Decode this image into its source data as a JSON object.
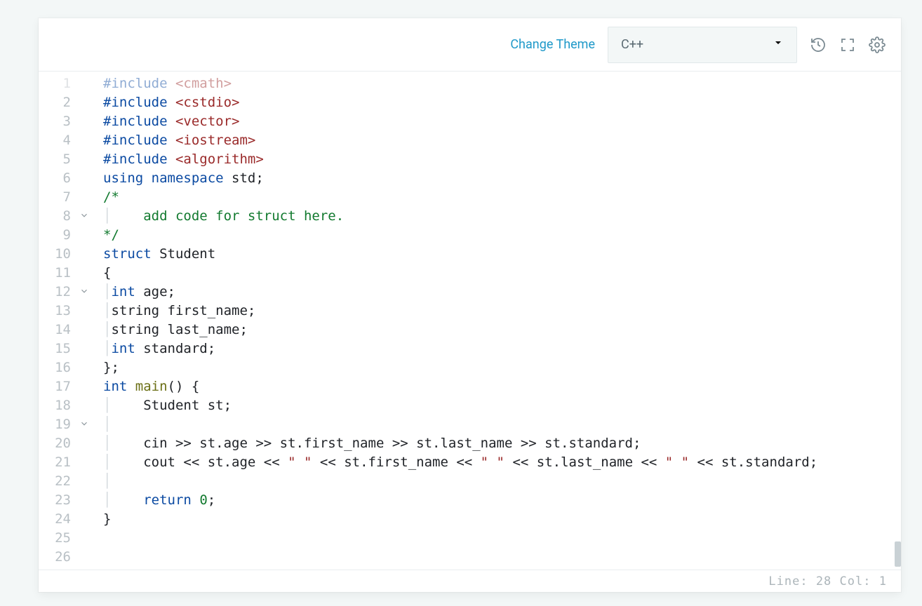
{
  "toolbar": {
    "change_theme": "Change Theme",
    "language": "C++",
    "icons": {
      "history": "history-icon",
      "fullscreen": "fullscreen-icon",
      "settings": "settings-icon"
    }
  },
  "status": {
    "line_label": "Line:",
    "line": "28",
    "col_label": "Col:",
    "col": "1"
  },
  "gutter": [
    {
      "n": "1",
      "fold": false,
      "faded": true
    },
    {
      "n": "2",
      "fold": false
    },
    {
      "n": "3",
      "fold": false
    },
    {
      "n": "4",
      "fold": false
    },
    {
      "n": "5",
      "fold": false
    },
    {
      "n": "6",
      "fold": false
    },
    {
      "n": "7",
      "fold": false
    },
    {
      "n": "8",
      "fold": true
    },
    {
      "n": "9",
      "fold": false
    },
    {
      "n": "10",
      "fold": false
    },
    {
      "n": "11",
      "fold": false
    },
    {
      "n": "12",
      "fold": true
    },
    {
      "n": "13",
      "fold": false
    },
    {
      "n": "14",
      "fold": false
    },
    {
      "n": "15",
      "fold": false
    },
    {
      "n": "16",
      "fold": false
    },
    {
      "n": "17",
      "fold": false
    },
    {
      "n": "18",
      "fold": false
    },
    {
      "n": "19",
      "fold": true
    },
    {
      "n": "20",
      "fold": false
    },
    {
      "n": "21",
      "fold": false
    },
    {
      "n": "22",
      "fold": false
    },
    {
      "n": "23",
      "fold": false
    },
    {
      "n": "24",
      "fold": false
    },
    {
      "n": "25",
      "fold": false
    },
    {
      "n": "26",
      "fold": false
    }
  ],
  "code": [
    {
      "faded": true,
      "tokens": [
        [
          "pp",
          "#include "
        ],
        [
          "inc",
          "<cmath>"
        ]
      ]
    },
    {
      "tokens": [
        [
          "pp",
          "#include "
        ],
        [
          "inc",
          "<cstdio>"
        ]
      ]
    },
    {
      "tokens": [
        [
          "pp",
          "#include "
        ],
        [
          "inc",
          "<vector>"
        ]
      ]
    },
    {
      "tokens": [
        [
          "pp",
          "#include "
        ],
        [
          "inc",
          "<iostream>"
        ]
      ]
    },
    {
      "tokens": [
        [
          "pp",
          "#include "
        ],
        [
          "inc",
          "<algorithm>"
        ]
      ]
    },
    {
      "tokens": [
        [
          "kw",
          "using"
        ],
        [
          "id",
          " "
        ],
        [
          "kw",
          "namespace"
        ],
        [
          "id",
          " std;"
        ]
      ]
    },
    {
      "tokens": [
        [
          "id",
          ""
        ]
      ]
    },
    {
      "tokens": [
        [
          "com",
          "/*"
        ]
      ]
    },
    {
      "indent": 1,
      "tokens": [
        [
          "com",
          "    add code for struct here."
        ]
      ]
    },
    {
      "tokens": [
        [
          "com",
          "*/"
        ]
      ]
    },
    {
      "tokens": [
        [
          "kw",
          "struct"
        ],
        [
          "id",
          " Student"
        ]
      ]
    },
    {
      "tokens": [
        [
          "id",
          "{"
        ]
      ]
    },
    {
      "indent": 1,
      "tokens": [
        [
          "kw",
          "int"
        ],
        [
          "id",
          " age;"
        ]
      ]
    },
    {
      "indent": 1,
      "tokens": [
        [
          "id",
          "string first_name;"
        ]
      ]
    },
    {
      "indent": 1,
      "tokens": [
        [
          "id",
          "string last_name;"
        ]
      ]
    },
    {
      "indent": 1,
      "tokens": [
        [
          "kw",
          "int"
        ],
        [
          "id",
          " standard;"
        ]
      ]
    },
    {
      "tokens": [
        [
          "id",
          "};"
        ]
      ]
    },
    {
      "tokens": [
        [
          "id",
          ""
        ]
      ]
    },
    {
      "tokens": [
        [
          "kw",
          "int"
        ],
        [
          "id",
          " "
        ],
        [
          "fn",
          "main"
        ],
        [
          "id",
          "() {"
        ]
      ]
    },
    {
      "indent": 1,
      "tokens": [
        [
          "id",
          "    Student st;"
        ]
      ]
    },
    {
      "indent": 1,
      "tokens": [
        [
          "id",
          "    "
        ]
      ]
    },
    {
      "indent": 1,
      "tokens": [
        [
          "id",
          "    cin >> st.age >> st.first_name >> st.last_name >> st.standard;"
        ]
      ]
    },
    {
      "indent": 1,
      "tokens": [
        [
          "id",
          "    cout << st.age << "
        ],
        [
          "str",
          "\" \""
        ],
        [
          "id",
          " << st.first_name << "
        ],
        [
          "str",
          "\" \""
        ],
        [
          "id",
          " << st.last_name << "
        ],
        [
          "str",
          "\" \""
        ],
        [
          "id",
          " << st.standard;"
        ]
      ]
    },
    {
      "indent": 1,
      "tokens": [
        [
          "id",
          "    "
        ]
      ]
    },
    {
      "indent": 1,
      "tokens": [
        [
          "id",
          "    "
        ],
        [
          "kw",
          "return"
        ],
        [
          "id",
          " "
        ],
        [
          "num",
          "0"
        ],
        [
          "id",
          ";"
        ]
      ]
    },
    {
      "tokens": [
        [
          "id",
          "}"
        ]
      ]
    }
  ]
}
